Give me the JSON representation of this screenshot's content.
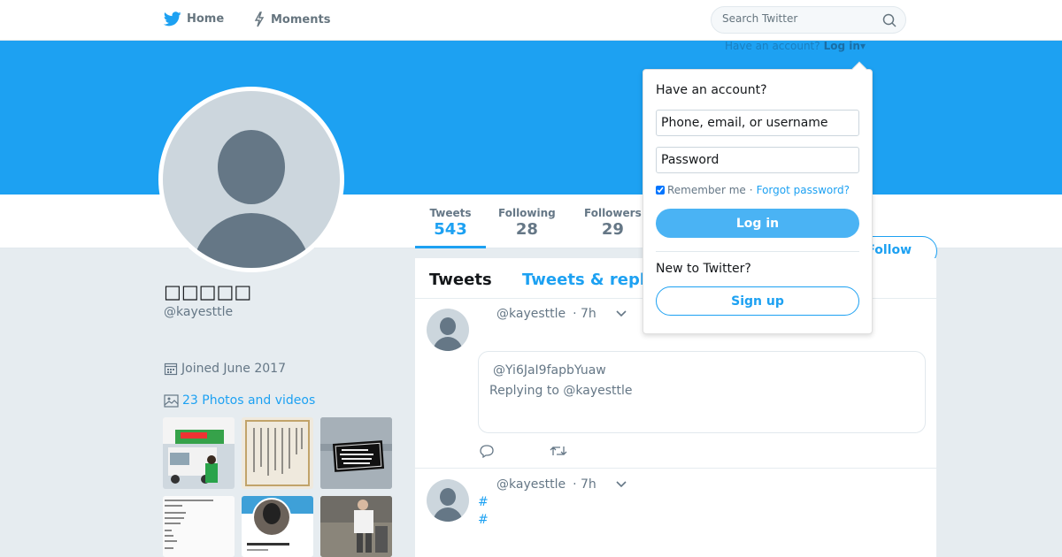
{
  "nav": {
    "home_label": "Home",
    "moments_label": "Moments",
    "search_placeholder": "Search Twitter"
  },
  "banner": {
    "have_account_text": "Have an account?",
    "login_link": "Log in▾",
    "color": "#1da1f2"
  },
  "stats": [
    {
      "label": "Tweets",
      "value": "543"
    },
    {
      "label": "Following",
      "value": "28"
    },
    {
      "label": "Followers",
      "value": "29"
    }
  ],
  "follow_label": "Follow",
  "profile": {
    "name": "□□□□□",
    "handle": "@kayesttle",
    "joined": "Joined June 2017",
    "photos_link": "23 Photos and videos"
  },
  "timeline": {
    "tabs": [
      "Tweets",
      "Tweets & repl"
    ],
    "tweets": [
      {
        "handle": "@kayesttle",
        "time": "· 7h",
        "quote_user": "@Yi6JaI9fapbYuaw",
        "quote_reply": "Replying to @kayesttle"
      },
      {
        "handle": "@kayesttle",
        "time": "· 7h",
        "hashtags": [
          "#",
          "#"
        ]
      }
    ]
  },
  "login_dropdown": {
    "title": "Have an account?",
    "username_placeholder": "Phone, email, or username",
    "password_placeholder": "Password",
    "remember_label": "Remember me",
    "separator": "·",
    "forgot_link": "Forgot password?",
    "login_button": "Log in",
    "new_text": "New to Twitter?",
    "signup_button": "Sign up"
  },
  "colors": {
    "accent": "#1da1f2",
    "login_button": "#4ab3f4"
  }
}
